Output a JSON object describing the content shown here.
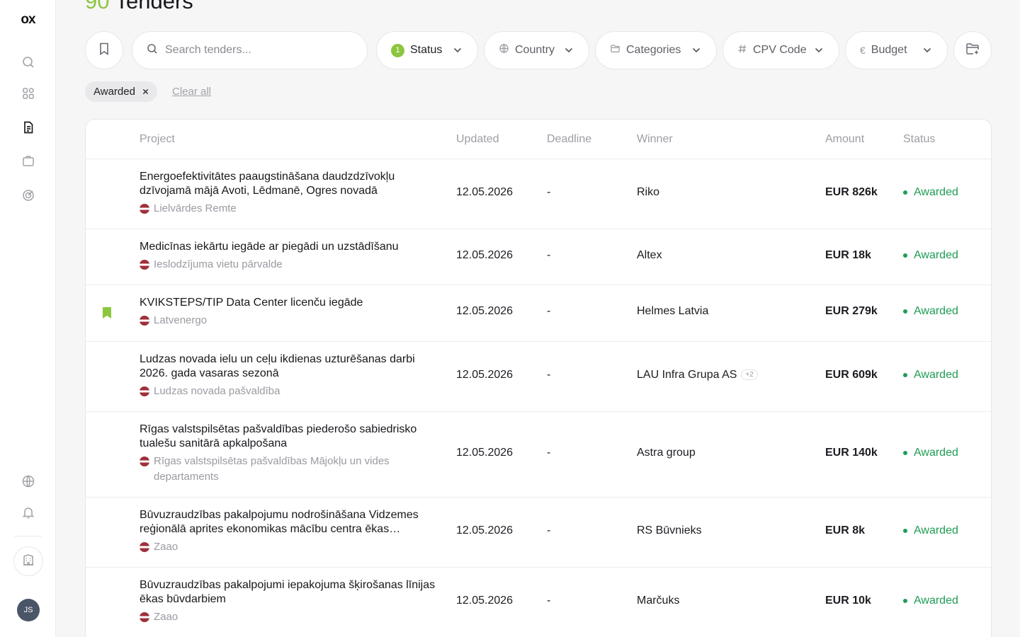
{
  "sidebar": {
    "logo": "ox",
    "avatar_initials": "JS",
    "icons": [
      "search-icon",
      "grid-icon",
      "document-icon",
      "briefcase-icon",
      "target-icon",
      "globe-icon",
      "bell-icon",
      "building-icon"
    ]
  },
  "header": {
    "count": "90",
    "title": "Tenders"
  },
  "toolbar": {
    "search_placeholder": "Search tenders...",
    "status": {
      "label": "Status",
      "count": "1"
    },
    "country": {
      "label": "Country"
    },
    "categories": {
      "label": "Categories"
    },
    "cpv": {
      "label": "CPV Code"
    },
    "budget": {
      "label": "Budget"
    }
  },
  "filters": {
    "active_chip": "Awarded",
    "clear_all": "Clear all"
  },
  "table": {
    "columns": {
      "project": "Project",
      "updated": "Updated",
      "deadline": "Deadline",
      "winner": "Winner",
      "amount": "Amount",
      "status": "Status"
    },
    "rows": [
      {
        "title": "Energoefektivitātes paaugstināšana daudzdzīvokļu dzīvojamā mājā Avoti, Lēdmanē, Ogres novadā",
        "buyer": "Lielvārdes Remte",
        "updated": "12.05.2026",
        "deadline": "-",
        "winner": "Riko",
        "extra": "",
        "amount": "EUR 826k",
        "status": "Awarded",
        "bookmarked": false
      },
      {
        "title": "Medicīnas iekārtu iegāde ar piegādi un uzstādīšanu",
        "buyer": "Ieslodzījuma vietu pārvalde",
        "updated": "12.05.2026",
        "deadline": "-",
        "winner": "Altex",
        "extra": "",
        "amount": "EUR 18k",
        "status": "Awarded",
        "bookmarked": false
      },
      {
        "title": "KVIKSTEPS/TIP Data Center licenču iegāde",
        "buyer": "Latvenergo",
        "updated": "12.05.2026",
        "deadline": "-",
        "winner": "Helmes Latvia",
        "extra": "",
        "amount": "EUR 279k",
        "status": "Awarded",
        "bookmarked": true
      },
      {
        "title": "Ludzas novada ielu un ceļu ikdienas uzturēšanas darbi 2026. gada vasaras sezonā",
        "buyer": "Ludzas novada pašvaldība",
        "updated": "12.05.2026",
        "deadline": "-",
        "winner": "LAU Infra Grupa AS",
        "extra": "+2",
        "amount": "EUR 609k",
        "status": "Awarded",
        "bookmarked": false
      },
      {
        "title": "Rīgas valstspilsētas pašvaldības piederošo sabiedrisko tualešu sanitārā apkalpošana",
        "buyer": "Rīgas valstspilsētas pašvaldības Mājokļu un vides departaments",
        "updated": "12.05.2026",
        "deadline": "-",
        "winner": "Astra group",
        "extra": "",
        "amount": "EUR 140k",
        "status": "Awarded",
        "bookmarked": false
      },
      {
        "title": "Būvuzraudzības pakalpojumu nodrošināšana Vidzemes reģionālā aprites ekonomikas mācību centra ēkas…",
        "buyer": "Zaao",
        "updated": "12.05.2026",
        "deadline": "-",
        "winner": "RS Būvnieks",
        "extra": "",
        "amount": "EUR 8k",
        "status": "Awarded",
        "bookmarked": false
      },
      {
        "title": "Būvuzraudzības pakalpojumi iepakojuma šķirošanas līnijas ēkas būvdarbiem",
        "buyer": "Zaao",
        "updated": "12.05.2026",
        "deadline": "-",
        "winner": "Marčuks",
        "extra": "",
        "amount": "EUR 10k",
        "status": "Awarded",
        "bookmarked": false
      }
    ]
  }
}
